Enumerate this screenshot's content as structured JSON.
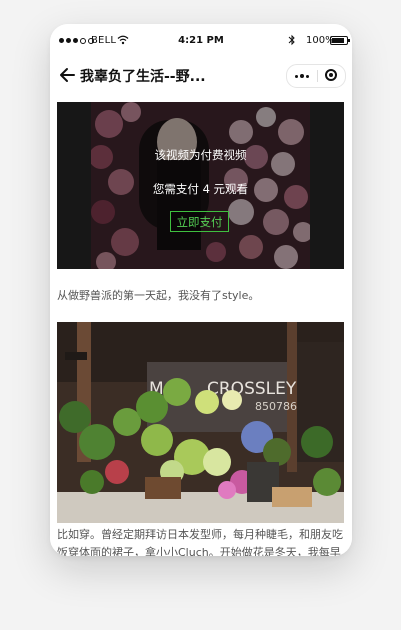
{
  "status_bar": {
    "carrier": "BELL",
    "time": "4:21 PM",
    "battery": "100%",
    "battery_level": 1.0
  },
  "nav": {
    "title": "我辜负了生活--野..."
  },
  "video": {
    "paid_title": "该视频为付费视频",
    "paid_note": "您需支付 4 元观看",
    "pay_button": "立即支付"
  },
  "article": {
    "paragraph1": "从做野兽派的第一天起，我没有了style。",
    "shop_sign_left": "MAR",
    "shop_sign_right": "CROSSLEY",
    "shop_number": "850786",
    "paragraph2_line1": "比如穿。曾经定期拜访日本发型师，每月种睫毛，和朋友吃",
    "paragraph2_line2": "饭穿体面的裙子，拿小小Cluch。开始做花是冬天，我每早"
  },
  "colors": {
    "accent_green": "#3fbf3f",
    "body_text": "#555555"
  }
}
